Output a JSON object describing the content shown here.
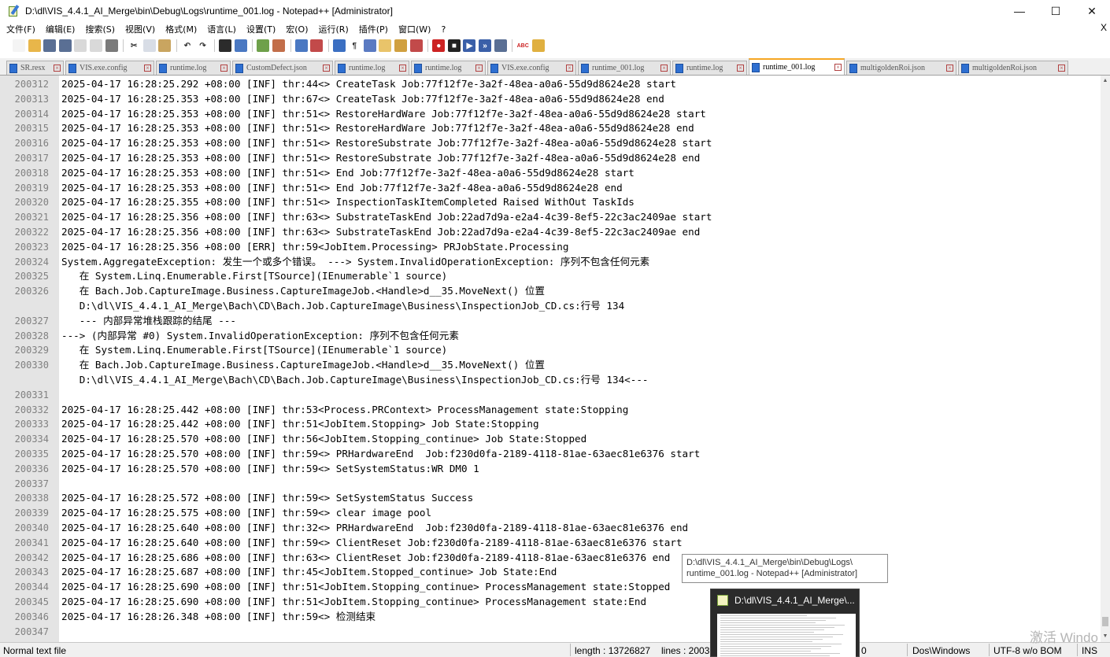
{
  "window": {
    "title": "D:\\dl\\VIS_4.4.1_AI_Merge\\bin\\Debug\\Logs\\runtime_001.log - Notepad++ [Administrator]",
    "minimize": "—",
    "maximize": "☐",
    "close": "✕"
  },
  "menu": {
    "items": [
      "文件(F)",
      "编辑(E)",
      "搜索(S)",
      "视图(V)",
      "格式(M)",
      "语言(L)",
      "设置(T)",
      "宏(O)",
      "运行(R)",
      "插件(P)",
      "窗口(W)",
      "?"
    ],
    "close": "X"
  },
  "toolbar": {
    "buttons": [
      {
        "icon": "new-file-icon",
        "color": "#f4f4f4",
        "glyph": ""
      },
      {
        "icon": "open-file-icon",
        "color": "#e8b64a",
        "glyph": ""
      },
      {
        "icon": "save-icon",
        "color": "#5a6f94",
        "glyph": ""
      },
      {
        "icon": "save-all-icon",
        "color": "#5a6f94",
        "glyph": ""
      },
      {
        "icon": "close-file-icon",
        "color": "#d9d9d9",
        "glyph": ""
      },
      {
        "icon": "close-all-icon",
        "color": "#d9d9d9",
        "glyph": ""
      },
      {
        "icon": "print-icon",
        "color": "#7a7a7a",
        "glyph": ""
      },
      {
        "sep": true
      },
      {
        "icon": "cut-icon",
        "color": "#ffffff",
        "glyph": "✂"
      },
      {
        "icon": "copy-icon",
        "color": "#d8dde6",
        "glyph": ""
      },
      {
        "icon": "paste-icon",
        "color": "#c9a560",
        "glyph": ""
      },
      {
        "sep": true
      },
      {
        "icon": "undo-icon",
        "color": "#ffffff",
        "glyph": "↶"
      },
      {
        "icon": "redo-icon",
        "color": "#ffffff",
        "glyph": "↷"
      },
      {
        "sep": true
      },
      {
        "icon": "find-icon",
        "color": "#2b2b2b",
        "glyph": ""
      },
      {
        "icon": "replace-icon",
        "color": "#4a78c2",
        "glyph": ""
      },
      {
        "sep": true
      },
      {
        "icon": "zoom-in-icon",
        "color": "#6ea04a",
        "glyph": ""
      },
      {
        "icon": "zoom-out-icon",
        "color": "#c26e4a",
        "glyph": ""
      },
      {
        "sep": true
      },
      {
        "icon": "sync-vertical-icon",
        "color": "#4a78c2",
        "glyph": ""
      },
      {
        "icon": "sync-horizontal-icon",
        "color": "#c24a4a",
        "glyph": ""
      },
      {
        "sep": true
      },
      {
        "icon": "word-wrap-icon",
        "color": "#3b6fc2",
        "glyph": ""
      },
      {
        "icon": "show-all-chars-icon",
        "color": "#ffffff",
        "glyph": "¶"
      },
      {
        "icon": "indent-guide-icon",
        "color": "#5a7ac2",
        "glyph": ""
      },
      {
        "icon": "udl-icon",
        "color": "#e9c46a",
        "glyph": ""
      },
      {
        "icon": "doc-map-icon",
        "color": "#d0a040",
        "glyph": ""
      },
      {
        "icon": "function-list-icon",
        "color": "#c24a4a",
        "glyph": ""
      },
      {
        "sep": true
      },
      {
        "icon": "record-macro-icon",
        "color": "#cc2222",
        "glyph": "●"
      },
      {
        "icon": "stop-record-icon",
        "color": "#222222",
        "glyph": "■"
      },
      {
        "icon": "play-macro-icon",
        "color": "#3a5fa8",
        "glyph": "▶"
      },
      {
        "icon": "play-multiple-icon",
        "color": "#3a5fa8",
        "glyph": "»"
      },
      {
        "icon": "save-macro-icon",
        "color": "#5a6f94",
        "glyph": ""
      },
      {
        "sep": true
      },
      {
        "icon": "spell-check-icon",
        "color": "#ffffff",
        "glyph": "ABC"
      },
      {
        "icon": "plugin-icon",
        "color": "#e0b040",
        "glyph": ""
      }
    ]
  },
  "tabs": [
    {
      "label": "SR.resx",
      "width": 73,
      "active": false
    },
    {
      "label": "VIS.exe.config",
      "width": 113,
      "active": false
    },
    {
      "label": "runtime.log",
      "width": 95,
      "active": false
    },
    {
      "label": "CustomDefect.json",
      "width": 128,
      "active": false
    },
    {
      "label": "runtime.log",
      "width": 95,
      "active": false
    },
    {
      "label": "runtime.log",
      "width": 95,
      "active": false
    },
    {
      "label": "VIS.exe.config",
      "width": 113,
      "active": false
    },
    {
      "label": "runtime_001.log",
      "width": 118,
      "active": false
    },
    {
      "label": "runtime.log",
      "width": 95,
      "active": false
    },
    {
      "label": "runtime_001.log",
      "width": 122,
      "active": true
    },
    {
      "label": "multigoldenRoi.json",
      "width": 140,
      "active": false
    },
    {
      "label": "multigoldenRoi.json",
      "width": 140,
      "active": false
    }
  ],
  "editor": {
    "lines": [
      {
        "n": "200312",
        "t": "2025-04-17 16:28:25.292 +08:00 [INF] thr:44<> CreateTask Job:77f12f7e-3a2f-48ea-a0a6-55d9d8624e28 start"
      },
      {
        "n": "200313",
        "t": "2025-04-17 16:28:25.353 +08:00 [INF] thr:67<> CreateTask Job:77f12f7e-3a2f-48ea-a0a6-55d9d8624e28 end"
      },
      {
        "n": "200314",
        "t": "2025-04-17 16:28:25.353 +08:00 [INF] thr:51<> RestoreHardWare Job:77f12f7e-3a2f-48ea-a0a6-55d9d8624e28 start"
      },
      {
        "n": "200315",
        "t": "2025-04-17 16:28:25.353 +08:00 [INF] thr:51<> RestoreHardWare Job:77f12f7e-3a2f-48ea-a0a6-55d9d8624e28 end"
      },
      {
        "n": "200316",
        "t": "2025-04-17 16:28:25.353 +08:00 [INF] thr:51<> RestoreSubstrate Job:77f12f7e-3a2f-48ea-a0a6-55d9d8624e28 start"
      },
      {
        "n": "200317",
        "t": "2025-04-17 16:28:25.353 +08:00 [INF] thr:51<> RestoreSubstrate Job:77f12f7e-3a2f-48ea-a0a6-55d9d8624e28 end"
      },
      {
        "n": "200318",
        "t": "2025-04-17 16:28:25.353 +08:00 [INF] thr:51<> End Job:77f12f7e-3a2f-48ea-a0a6-55d9d8624e28 start"
      },
      {
        "n": "200319",
        "t": "2025-04-17 16:28:25.353 +08:00 [INF] thr:51<> End Job:77f12f7e-3a2f-48ea-a0a6-55d9d8624e28 end"
      },
      {
        "n": "200320",
        "t": "2025-04-17 16:28:25.355 +08:00 [INF] thr:51<> InspectionTaskItemCompleted Raised WithOut TaskIds"
      },
      {
        "n": "200321",
        "t": "2025-04-17 16:28:25.356 +08:00 [INF] thr:63<> SubstrateTaskEnd Job:22ad7d9a-e2a4-4c39-8ef5-22c3ac2409ae start"
      },
      {
        "n": "200322",
        "t": "2025-04-17 16:28:25.356 +08:00 [INF] thr:63<> SubstrateTaskEnd Job:22ad7d9a-e2a4-4c39-8ef5-22c3ac2409ae end"
      },
      {
        "n": "200323",
        "t": "2025-04-17 16:28:25.356 +08:00 [ERR] thr:59<JobItem.Processing> PRJobState.Processing"
      },
      {
        "n": "200324",
        "t": "System.AggregateException: 发生一个或多个错误。 ---> System.InvalidOperationException: 序列不包含任何元素"
      },
      {
        "n": "200325",
        "t": "   在 System.Linq.Enumerable.First[TSource](IEnumerable`1 source)"
      },
      {
        "n": "200326",
        "t": "   在 Bach.Job.CaptureImage.Business.CaptureImageJob.<Handle>d__35.MoveNext() 位置"
      },
      {
        "n": "",
        "t": "   D:\\dl\\VIS_4.4.1_AI_Merge\\Bach\\CD\\Bach.Job.CaptureImage\\Business\\InspectionJob_CD.cs:行号 134"
      },
      {
        "n": "200327",
        "t": "   --- 内部异常堆栈跟踪的结尾 ---"
      },
      {
        "n": "200328",
        "t": "---> (内部异常 #0) System.InvalidOperationException: 序列不包含任何元素"
      },
      {
        "n": "200329",
        "t": "   在 System.Linq.Enumerable.First[TSource](IEnumerable`1 source)"
      },
      {
        "n": "200330",
        "t": "   在 Bach.Job.CaptureImage.Business.CaptureImageJob.<Handle>d__35.MoveNext() 位置"
      },
      {
        "n": "",
        "t": "   D:\\dl\\VIS_4.4.1_AI_Merge\\Bach\\CD\\Bach.Job.CaptureImage\\Business\\InspectionJob_CD.cs:行号 134<---"
      },
      {
        "n": "200331",
        "t": ""
      },
      {
        "n": "200332",
        "t": "2025-04-17 16:28:25.442 +08:00 [INF] thr:53<Process.PRContext> ProcessManagement state:Stopping"
      },
      {
        "n": "200333",
        "t": "2025-04-17 16:28:25.442 +08:00 [INF] thr:51<JobItem.Stopping> Job State:Stopping"
      },
      {
        "n": "200334",
        "t": "2025-04-17 16:28:25.570 +08:00 [INF] thr:56<JobItem.Stopping_continue> Job State:Stopped"
      },
      {
        "n": "200335",
        "t": "2025-04-17 16:28:25.570 +08:00 [INF] thr:59<> PRHardwareEnd  Job:f230d0fa-2189-4118-81ae-63aec81e6376 start"
      },
      {
        "n": "200336",
        "t": "2025-04-17 16:28:25.570 +08:00 [INF] thr:59<> SetSystemStatus:WR DM0 1"
      },
      {
        "n": "200337",
        "t": ""
      },
      {
        "n": "200338",
        "t": "2025-04-17 16:28:25.572 +08:00 [INF] thr:59<> SetSystemStatus Success"
      },
      {
        "n": "200339",
        "t": "2025-04-17 16:28:25.575 +08:00 [INF] thr:59<> clear image pool"
      },
      {
        "n": "200340",
        "t": "2025-04-17 16:28:25.640 +08:00 [INF] thr:32<> PRHardwareEnd  Job:f230d0fa-2189-4118-81ae-63aec81e6376 end"
      },
      {
        "n": "200341",
        "t": "2025-04-17 16:28:25.640 +08:00 [INF] thr:59<> ClientReset Job:f230d0fa-2189-4118-81ae-63aec81e6376 start"
      },
      {
        "n": "200342",
        "t": "2025-04-17 16:28:25.686 +08:00 [INF] thr:63<> ClientReset Job:f230d0fa-2189-4118-81ae-63aec81e6376 end"
      },
      {
        "n": "200343",
        "t": "2025-04-17 16:28:25.687 +08:00 [INF] thr:45<JobItem.Stopped_continue> Job State:End"
      },
      {
        "n": "200344",
        "t": "2025-04-17 16:28:25.690 +08:00 [INF] thr:51<JobItem.Stopping_continue> ProcessManagement state:Stopped"
      },
      {
        "n": "200345",
        "t": "2025-04-17 16:28:25.690 +08:00 [INF] thr:51<JobItem.Stopping_continue> ProcessManagement state:End"
      },
      {
        "n": "200346",
        "t": "2025-04-17 16:28:26.348 +08:00 [INF] thr:59<> 检测结束"
      },
      {
        "n": "200347",
        "t": ""
      }
    ]
  },
  "scrollbar": {
    "up": "▲",
    "down": "▼"
  },
  "status": {
    "file_type": "Normal text file",
    "length": "length : 13726827",
    "lines": "lines : 2003",
    "col": "0",
    "eol": "Dos\\Windows",
    "encoding": "UTF-8 w/o BOM",
    "mode": "INS"
  },
  "tooltip": {
    "line1": "D:\\dl\\VIS_4.4.1_AI_Merge\\bin\\Debug\\Logs\\",
    "line2": "runtime_001.log - Notepad++ [Administrator]"
  },
  "taskbar_preview": {
    "title": "D:\\dl\\VIS_4.4.1_AI_Merge\\..."
  },
  "watermark": "激活 Windo"
}
